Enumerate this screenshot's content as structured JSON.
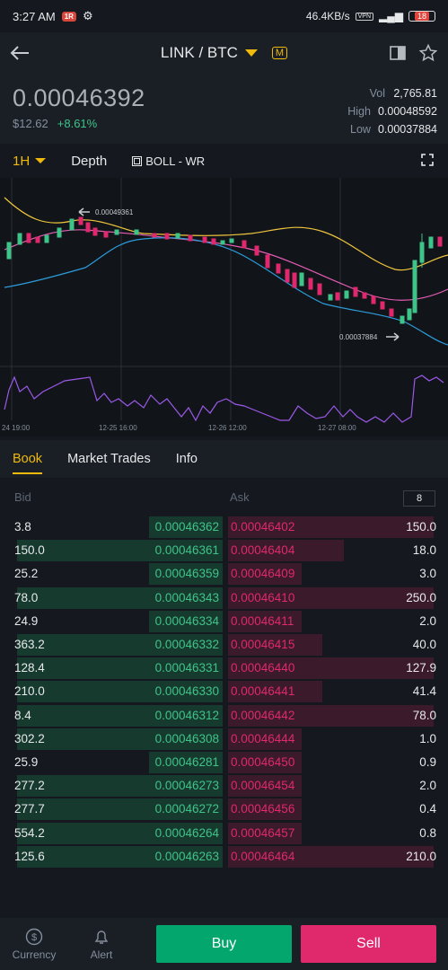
{
  "status_bar": {
    "time": "3:27 AM",
    "notification_badge": "1R",
    "net_speed": "46.4KB/s",
    "vpn": "VPN",
    "battery": "18"
  },
  "header": {
    "pair": "LINK / BTC",
    "margin_badge": "M"
  },
  "ticker": {
    "last_price": "0.00046392",
    "fiat_price": "$12.62",
    "change": "+8.61%",
    "vol_label": "Vol",
    "vol": "2,765.81",
    "high_label": "High",
    "high": "0.00048592",
    "low_label": "Low",
    "low": "0.00037884"
  },
  "chart_toolbar": {
    "timeframe": "1H",
    "depth": "Depth",
    "indicators": "BOLL - WR"
  },
  "chart": {
    "high_marker": "0.00049361",
    "low_marker": "0.00037884",
    "x_labels": [
      "24 19:00",
      "12-25 16:00",
      "12-26 12:00",
      "12-27 08:00"
    ]
  },
  "tabs": [
    "Book",
    "Market Trades",
    "Info"
  ],
  "book": {
    "bid_label": "Bid",
    "ask_label": "Ask",
    "depth": "8",
    "rows": [
      {
        "bid_qty": "3.8",
        "bid_price": "0.00046362",
        "ask_price": "0.00046402",
        "ask_qty": "150.0",
        "bid_depth": 0.35,
        "ask_depth": 0.98
      },
      {
        "bid_qty": "150.0",
        "bid_price": "0.00046361",
        "ask_price": "0.00046404",
        "ask_qty": "18.0",
        "bid_depth": 0.98,
        "ask_depth": 0.55
      },
      {
        "bid_qty": "25.2",
        "bid_price": "0.00046359",
        "ask_price": "0.00046409",
        "ask_qty": "3.0",
        "bid_depth": 0.35,
        "ask_depth": 0.35
      },
      {
        "bid_qty": "78.0",
        "bid_price": "0.00046343",
        "ask_price": "0.00046410",
        "ask_qty": "250.0",
        "bid_depth": 0.98,
        "ask_depth": 0.98
      },
      {
        "bid_qty": "24.9",
        "bid_price": "0.00046334",
        "ask_price": "0.00046411",
        "ask_qty": "2.0",
        "bid_depth": 0.35,
        "ask_depth": 0.35
      },
      {
        "bid_qty": "363.2",
        "bid_price": "0.00046332",
        "ask_price": "0.00046415",
        "ask_qty": "40.0",
        "bid_depth": 0.98,
        "ask_depth": 0.45
      },
      {
        "bid_qty": "128.4",
        "bid_price": "0.00046331",
        "ask_price": "0.00046440",
        "ask_qty": "127.9",
        "bid_depth": 0.98,
        "ask_depth": 0.98
      },
      {
        "bid_qty": "210.0",
        "bid_price": "0.00046330",
        "ask_price": "0.00046441",
        "ask_qty": "41.4",
        "bid_depth": 0.98,
        "ask_depth": 0.45
      },
      {
        "bid_qty": "8.4",
        "bid_price": "0.00046312",
        "ask_price": "0.00046442",
        "ask_qty": "78.0",
        "bid_depth": 0.98,
        "ask_depth": 0.98
      },
      {
        "bid_qty": "302.2",
        "bid_price": "0.00046308",
        "ask_price": "0.00046444",
        "ask_qty": "1.0",
        "bid_depth": 0.98,
        "ask_depth": 0.35
      },
      {
        "bid_qty": "25.9",
        "bid_price": "0.00046281",
        "ask_price": "0.00046450",
        "ask_qty": "0.9",
        "bid_depth": 0.35,
        "ask_depth": 0.35
      },
      {
        "bid_qty": "277.2",
        "bid_price": "0.00046273",
        "ask_price": "0.00046454",
        "ask_qty": "2.0",
        "bid_depth": 0.98,
        "ask_depth": 0.35
      },
      {
        "bid_qty": "277.7",
        "bid_price": "0.00046272",
        "ask_price": "0.00046456",
        "ask_qty": "0.4",
        "bid_depth": 0.98,
        "ask_depth": 0.35
      },
      {
        "bid_qty": "554.2",
        "bid_price": "0.00046264",
        "ask_price": "0.00046457",
        "ask_qty": "0.8",
        "bid_depth": 0.98,
        "ask_depth": 0.35
      },
      {
        "bid_qty": "125.6",
        "bid_price": "0.00046263",
        "ask_price": "0.00046464",
        "ask_qty": "210.0",
        "bid_depth": 0.98,
        "ask_depth": 0.98
      }
    ]
  },
  "bottom_bar": {
    "currency": "Currency",
    "alert": "Alert",
    "buy": "Buy",
    "sell": "Sell"
  },
  "colors": {
    "accent": "#f0b90b",
    "buy_green": "#3ec489",
    "sell_red": "#e0286d",
    "buy_button": "#03a66d",
    "sell_button": "#e0286d"
  }
}
